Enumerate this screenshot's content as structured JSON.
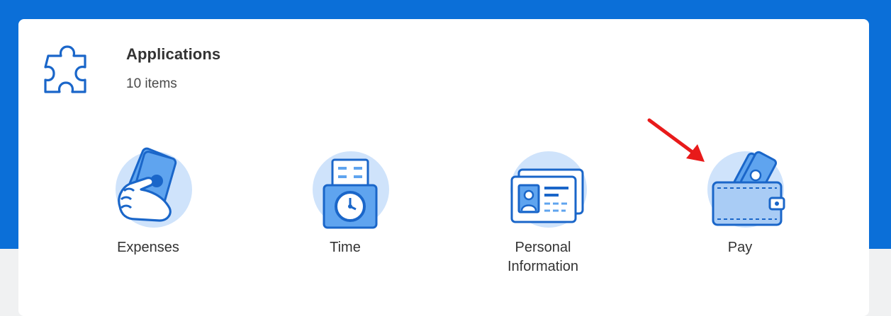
{
  "header": {
    "title": "Applications",
    "count": "10 items",
    "icon": "puzzle-icon"
  },
  "apps": [
    {
      "label": "Expenses",
      "icon": "cash-hand-icon"
    },
    {
      "label": "Time",
      "icon": "time-clock-icon"
    },
    {
      "label": "Personal\nInformation",
      "icon": "id-card-icon"
    },
    {
      "label": "Pay",
      "icon": "wallet-icon"
    }
  ],
  "colors": {
    "brand_blue": "#0b6fd8",
    "icon_stroke": "#1a66c9",
    "icon_fill_light": "#cfe3fb",
    "icon_fill_mid": "#5fa4ef",
    "arrow": "#e81a1a"
  }
}
